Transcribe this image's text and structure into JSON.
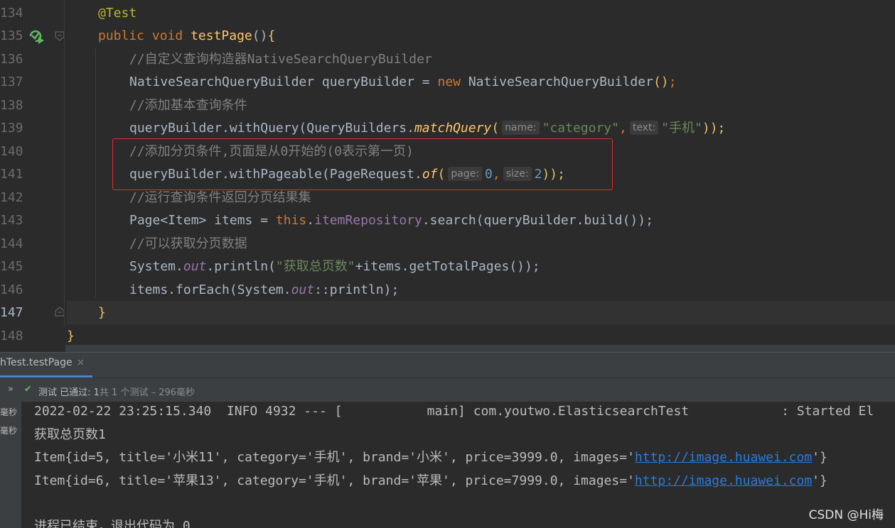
{
  "editor": {
    "line_numbers": [
      "134",
      "135",
      "136",
      "137",
      "138",
      "139",
      "140",
      "141",
      "142",
      "143",
      "144",
      "145",
      "146",
      "147",
      "148"
    ],
    "current_line": "147",
    "lines": [
      {
        "l134_ann": "@Test"
      },
      {},
      {
        "l136_comment": "//自定义查询构造器NativeSearchQueryBuilder"
      },
      {},
      {
        "l138_comment": "//添加基本查询条件"
      }
    ],
    "l135": {
      "kw_public": "public",
      "kw_void": "void",
      "fn": "testPage",
      "paren": "()",
      "brace": "{"
    },
    "l137": {
      "type": "NativeSearchQueryBuilder queryBuilder = ",
      "kw_new": "new",
      "rest": " NativeSearchQueryBuilder",
      "parens": "()",
      "semi": ";"
    },
    "l139": {
      "a": "queryBuilder.withQuery(QueryBuilders.",
      "method": "matchQuery",
      "open": "(",
      "hint_name": "name:",
      "arg1": "\"category\"",
      "comma": ",",
      "hint_text": "text:",
      "arg2": "\"手机\"",
      "close": "));"
    },
    "l140": {
      "comment": "//添加分页条件,页面是从0开始的(0表示第一页)"
    },
    "l141": {
      "a": "queryBuilder.withPageable(PageRequest.",
      "method": "of",
      "open": "(",
      "hint_page": "page:",
      "n0": "0",
      "comma": ",",
      "hint_size": "size:",
      "n2": "2",
      "close": "));"
    },
    "l142": {
      "comment": "//运行查询条件返回分页结果集"
    },
    "l143": {
      "a": "Page<Item> items = ",
      "kw_this": "this",
      "dot": ".",
      "field": "itemRepository",
      "rest": ".search(queryBuilder.build());"
    },
    "l144": {
      "comment": "//可以获取分页数据"
    },
    "l145": {
      "a": "System.",
      "out": "out",
      "b": ".println(",
      "str": "\"获取总页数\"",
      "rest": "+items.getTotalPages());"
    },
    "l146": {
      "a": "items.forEach(System.",
      "out": "out",
      "rest": "::println);"
    },
    "l147": {
      "brace": "}"
    },
    "l148": {
      "brace": "}"
    }
  },
  "run_panel": {
    "tab_label": "hTest.testPage",
    "tab_close": "×",
    "status_check": "✔",
    "status_text_main": "测试 已通过: 1",
    "status_text_dim": "共 1 个测试 – 296毫秒",
    "left_strip": [
      "毫秒",
      "毫秒"
    ],
    "console_lines": [
      "2022-02-22 23:25:15.340  INFO 4932 --- [           main] com.youtwo.ElasticsearchTest            : Started El",
      "获取总页数1"
    ],
    "item5_prefix": "Item{id=5, title='小米11', category='手机', brand='小米', price=3999.0, images='",
    "item6_prefix": "Item{id=6, title='苹果13', category='手机', brand='苹果', price=7999.0, images='",
    "link": "http://image.huawei.com",
    "item_suffix": "'}",
    "exit_line": "进程已结束，退出代码为 0"
  },
  "watermark": "CSDN @Hi梅",
  "colors": {
    "highlight_box": "#e02b2b",
    "pass_green": "#5fb760",
    "link": "#287bde"
  }
}
